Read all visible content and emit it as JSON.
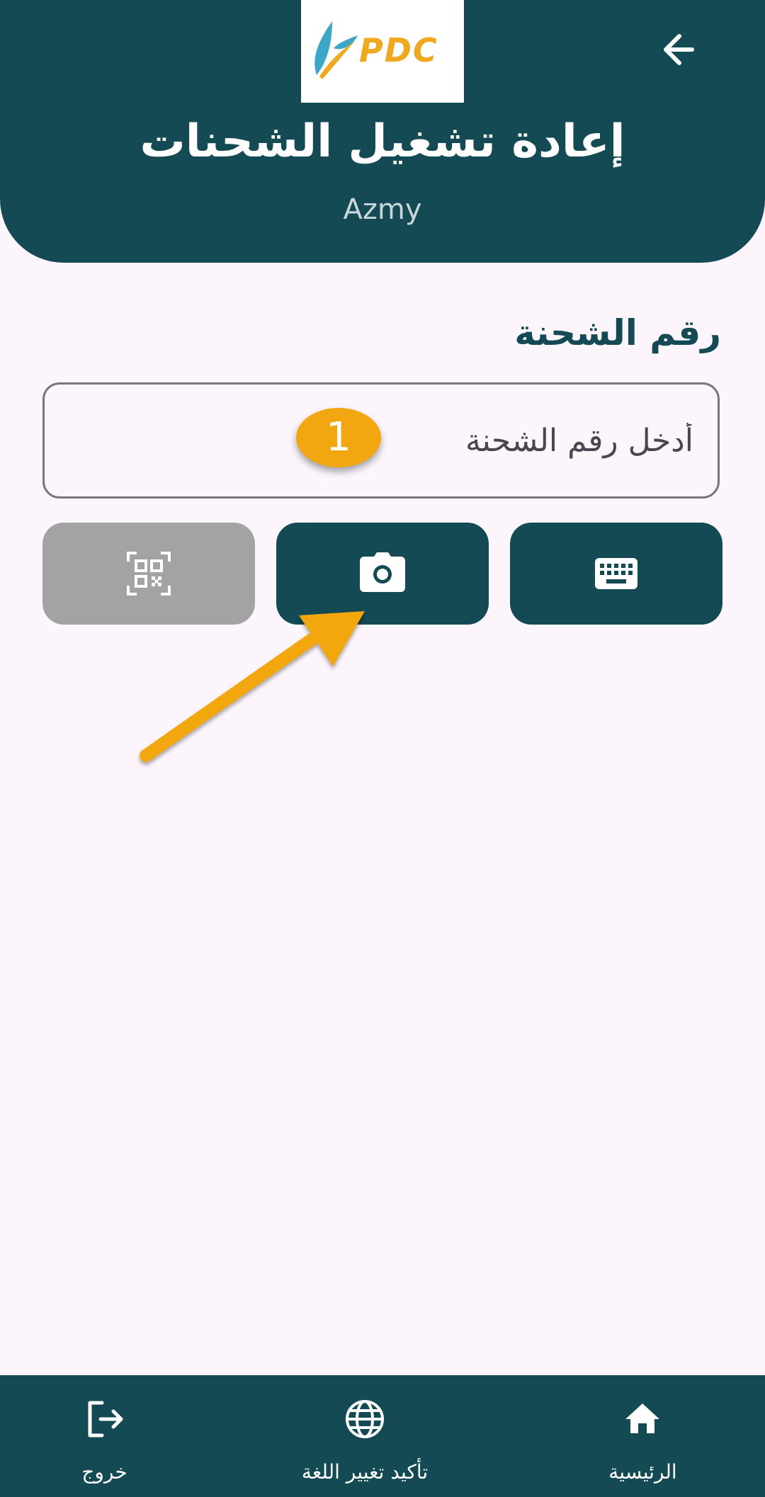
{
  "header": {
    "logo_text": "PDC",
    "title": "إعادة تشغيل الشحنات",
    "subtitle": "Azmy",
    "back_icon": "arrow-left-icon"
  },
  "form": {
    "label": "رقم الشحنة",
    "input_placeholder": "أدخل رقم الشحنة",
    "input_value": ""
  },
  "annotation": {
    "step_number": "1",
    "color": "#f2a710"
  },
  "actions": [
    {
      "icon": "keyboard-icon",
      "enabled": true
    },
    {
      "icon": "camera-icon",
      "enabled": true
    },
    {
      "icon": "qr-code-icon",
      "enabled": false
    }
  ],
  "bottom_nav": {
    "home": {
      "label": "الرئيسية",
      "icon": "home-icon"
    },
    "language": {
      "label": "تأكيد تغيير اللغة",
      "icon": "globe-icon"
    },
    "exit": {
      "label": "خروج",
      "icon": "logout-icon"
    }
  },
  "colors": {
    "primary": "#134a54",
    "background": "#fcf6fc",
    "disabled": "#a3a3a3",
    "logo_accent": "#f1a81d"
  }
}
